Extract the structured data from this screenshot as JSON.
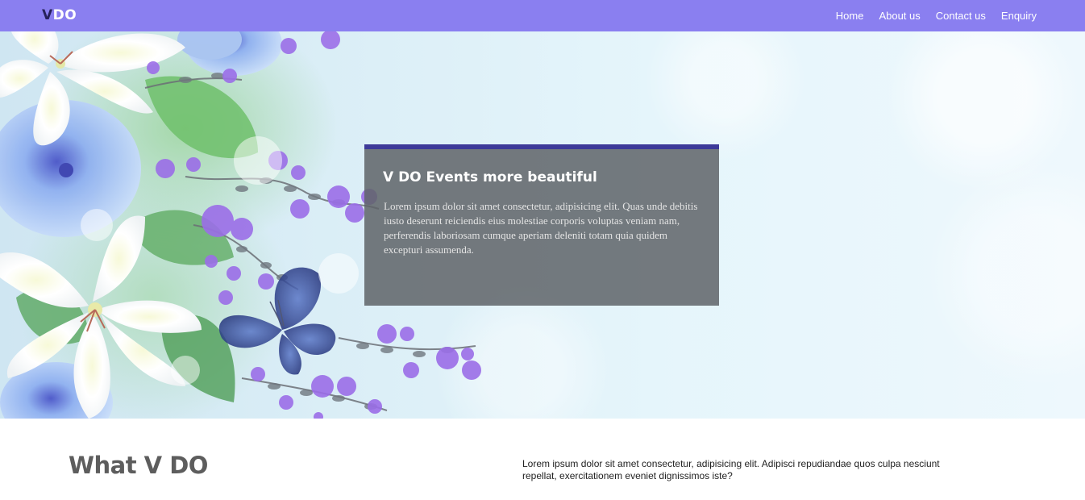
{
  "navbar": {
    "logo_v": "V",
    "logo_rest": "DO",
    "links": [
      "Home",
      "About us",
      "Contact us",
      "Enquiry"
    ],
    "background": "#8a7ff0"
  },
  "hero": {
    "title": "V DO Events more beautiful",
    "text": "Lorem ipsum dolor sit amet consectetur, adipisicing elit. Quas unde debitis iusto deserunt reiciendis eius molestiae corporis voluptas veniam nam, perferendis laboriosam cumque aperiam deleniti totam quia quidem excepturi assumenda.",
    "accent": "#3d3a99"
  },
  "about": {
    "title": "What V DO",
    "text": "Lorem ipsum dolor sit amet consectetur, adipisicing elit. Adipisci repudiandae quos culpa nesciunt repellat, exercitationem eveniet dignissimos iste?"
  }
}
